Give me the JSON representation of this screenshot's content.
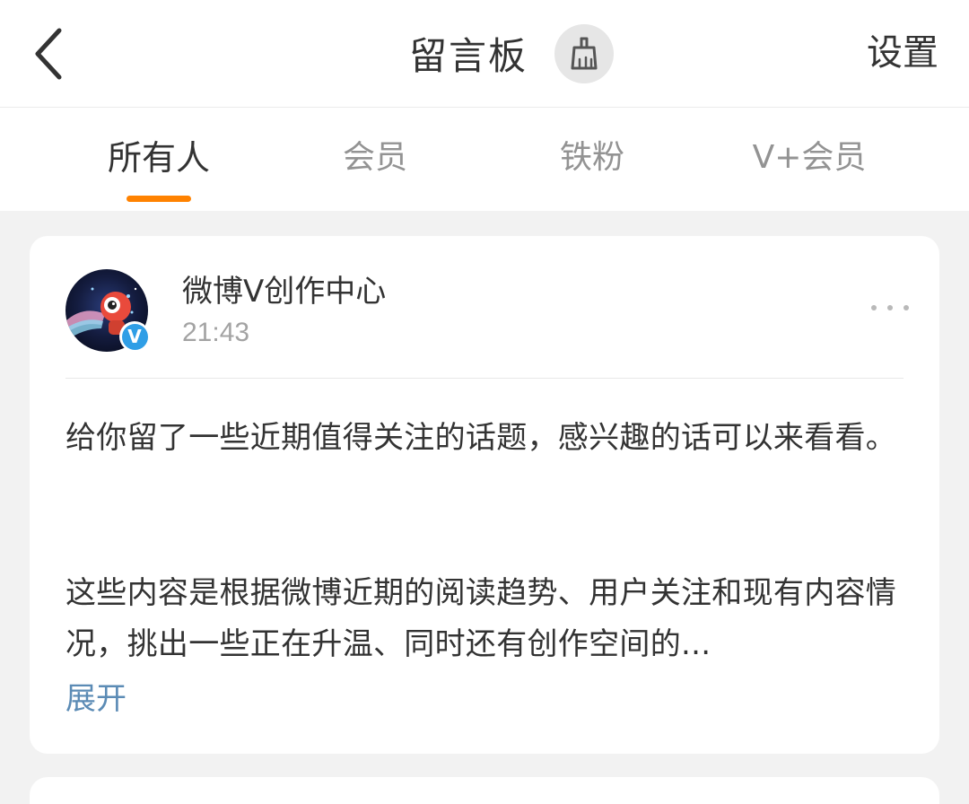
{
  "header": {
    "title": "留言板",
    "settings_label": "设置",
    "back_icon": "chevron-left-icon",
    "clean_icon": "broom-icon"
  },
  "tabs": [
    {
      "label": "所有人",
      "active": true
    },
    {
      "label": "会员",
      "active": false
    },
    {
      "label": "铁粉",
      "active": false
    },
    {
      "label": "V+会员",
      "active": false
    }
  ],
  "message": {
    "author": "微博Ⅴ创作中心",
    "time": "21:43",
    "verified_label": "V",
    "paragraph1": "给你留了一些近期值得关注的话题，感兴趣的话可以来看看。",
    "paragraph2": "这些内容是根据微博近期的阅读趋势、用户关注和现有内容情况，挑出一些正在升温、同时还有创作空间的...",
    "expand_label": "展开"
  },
  "colors": {
    "accent": "#ff8200",
    "link": "#5b8bb5",
    "verified": "#2f9ee6",
    "background": "#f2f2f2"
  }
}
